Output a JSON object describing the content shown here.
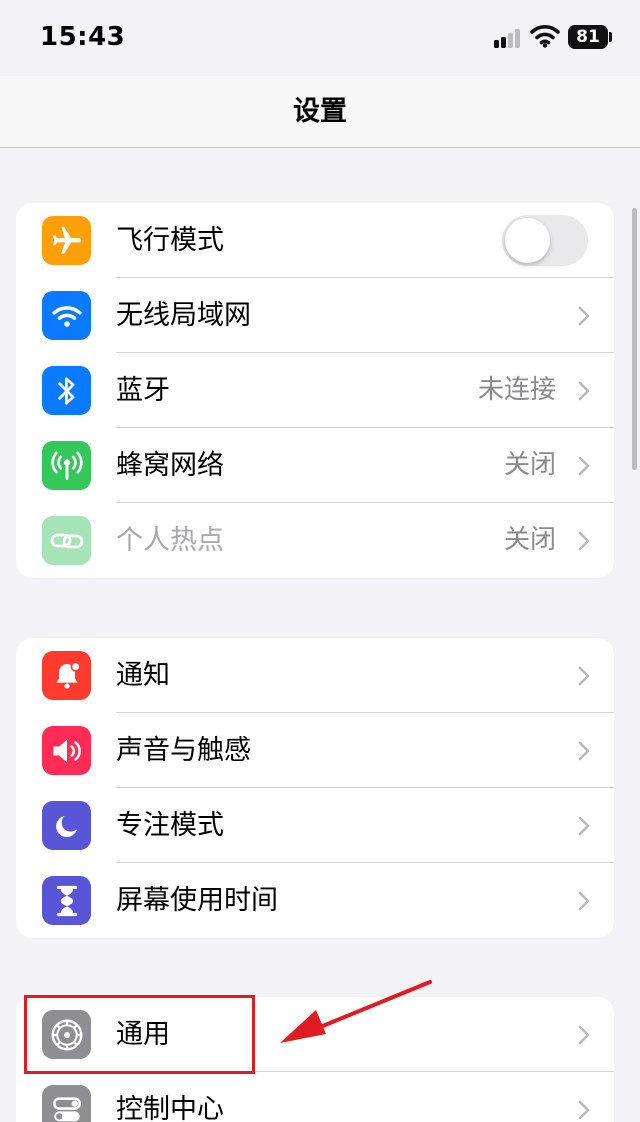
{
  "status_bar": {
    "time": "15:43",
    "battery": "81"
  },
  "nav": {
    "title": "设置"
  },
  "group1": [
    {
      "label": "飞行模式",
      "icon": "airplane-icon",
      "color": "#ff9f0a",
      "toggle": "off"
    },
    {
      "label": "无线局域网",
      "icon": "wifi-icon",
      "color": "#0a7aff",
      "value": ""
    },
    {
      "label": "蓝牙",
      "icon": "bluetooth-icon",
      "color": "#0a7aff",
      "value": "未连接"
    },
    {
      "label": "蜂窝网络",
      "icon": "cellular-icon",
      "color": "#34c759",
      "value": "关闭"
    },
    {
      "label": "个人热点",
      "icon": "hotspot-icon",
      "color": "#34c759",
      "value": "关闭",
      "disabled": true
    }
  ],
  "group2": [
    {
      "label": "通知",
      "icon": "notification-icon",
      "color": "#ff3b30"
    },
    {
      "label": "声音与触感",
      "icon": "speaker-icon",
      "color": "#ff2d55"
    },
    {
      "label": "专注模式",
      "icon": "moon-icon",
      "color": "#5856d6"
    },
    {
      "label": "屏幕使用时间",
      "icon": "hourglass-icon",
      "color": "#5856d6"
    }
  ],
  "group3": [
    {
      "label": "通用",
      "icon": "gear-icon",
      "color": "#8e8e93"
    },
    {
      "label": "控制中心",
      "icon": "toggles-icon",
      "color": "#8e8e93"
    }
  ],
  "annotation": {
    "highlight_color": "#e11b22",
    "highlighted_item": "通用"
  }
}
